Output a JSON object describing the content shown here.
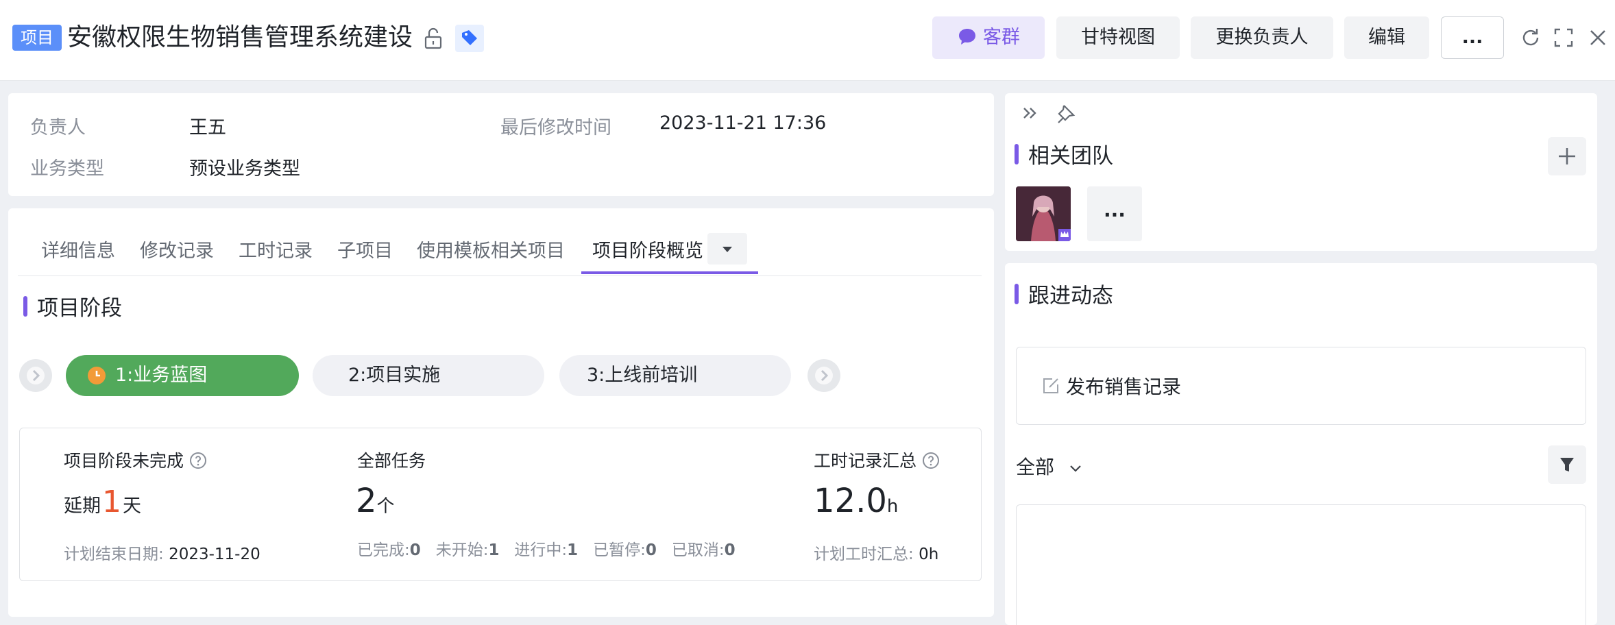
{
  "header": {
    "tag": "项目",
    "title": "安徽权限生物销售管理系统建设",
    "buttons": {
      "group_chat": "客群",
      "gantt": "甘特视图",
      "change_owner": "更换负责人",
      "edit": "编辑",
      "more": "..."
    }
  },
  "info": {
    "owner_label": "负责人",
    "owner_value": "王五",
    "modified_label": "最后修改时间",
    "modified_value": "2023-11-21 17:36",
    "biz_label": "业务类型",
    "biz_value": "预设业务类型"
  },
  "tabs": [
    {
      "label": "详细信息"
    },
    {
      "label": "修改记录"
    },
    {
      "label": "工时记录"
    },
    {
      "label": "子项目"
    },
    {
      "label": "使用模板相关项目"
    },
    {
      "label": "项目阶段概览"
    }
  ],
  "stages": {
    "section_title": "项目阶段",
    "items": [
      {
        "label": "1:业务蓝图",
        "status": "current"
      },
      {
        "label": "2:项目实施",
        "status": "pending"
      },
      {
        "label": "3:上线前培训",
        "status": "pending"
      }
    ]
  },
  "summary": {
    "incomplete_label": "项目阶段未完成",
    "delay_prefix": "延期",
    "delay_value": "1",
    "delay_unit": "天",
    "plan_end_label": "计划结束日期:",
    "plan_end_value": "2023-11-20",
    "tasks_label": "全部任务",
    "tasks_value": "2",
    "tasks_unit": "个",
    "task_stats": [
      {
        "label": "已完成:",
        "value": "0"
      },
      {
        "label": "未开始:",
        "value": "1"
      },
      {
        "label": "进行中:",
        "value": "1"
      },
      {
        "label": "已暂停:",
        "value": "0"
      },
      {
        "label": "已取消:",
        "value": "0"
      }
    ],
    "hours_label": "工时记录汇总",
    "hours_value": "12.0",
    "hours_unit": "h",
    "plan_hours_label": "计划工时汇总:",
    "plan_hours_value": "0h"
  },
  "team": {
    "title": "相关团队",
    "more": "..."
  },
  "dynamics": {
    "title": "跟进动态",
    "publish": "发布销售记录",
    "filter": "全部"
  },
  "colors": {
    "accent": "#7a5ae6",
    "stage_current": "#52a95b",
    "delay": "#e8562f",
    "tag": "#5b8ff9"
  }
}
